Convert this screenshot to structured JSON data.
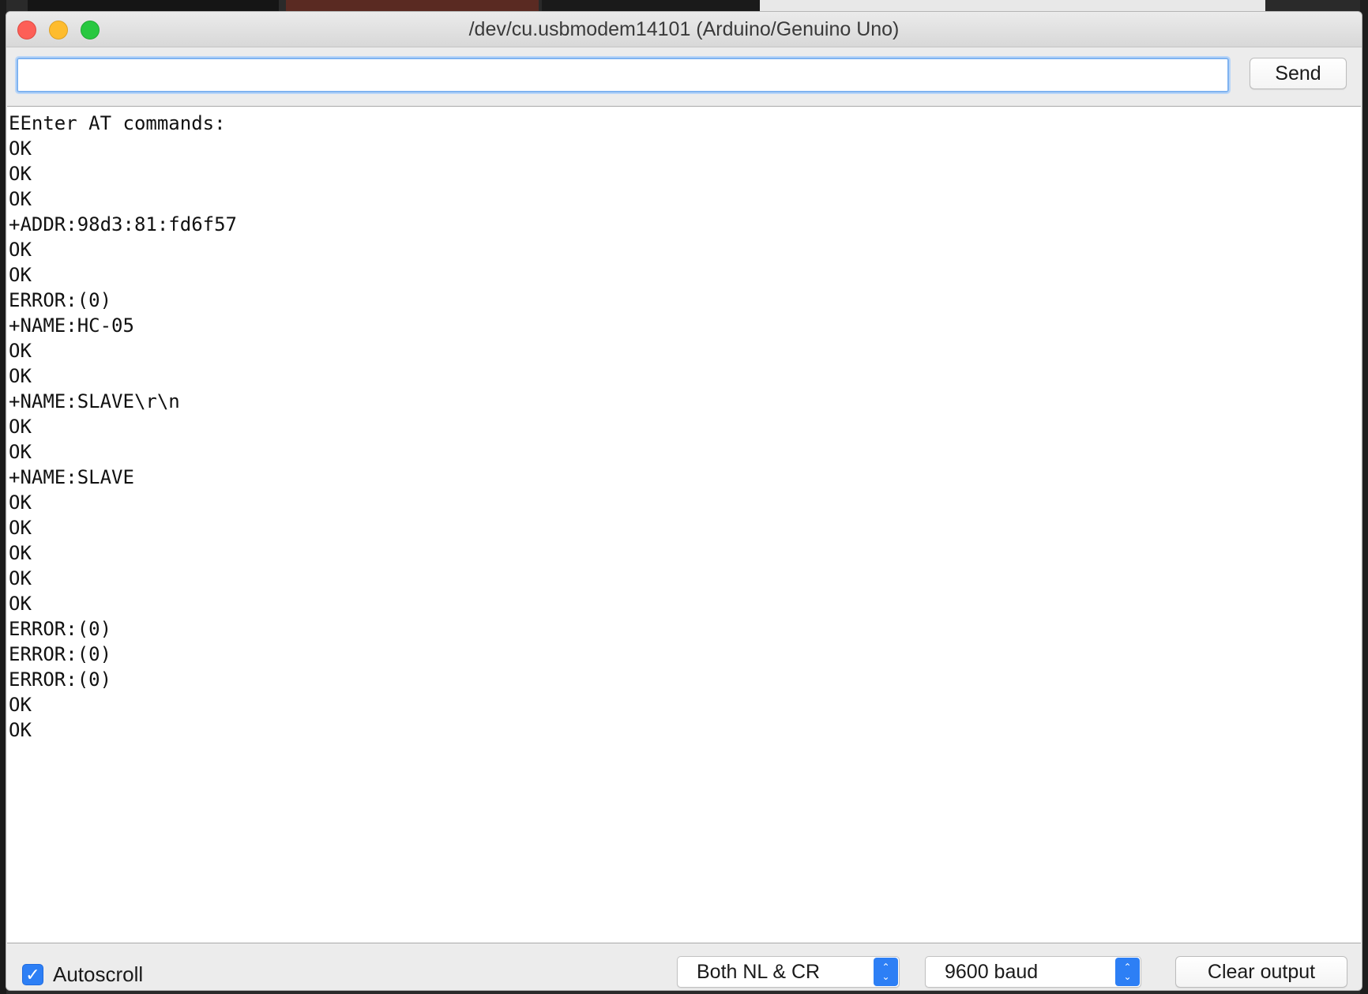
{
  "window": {
    "title": "/dev/cu.usbmodem14101 (Arduino/Genuino Uno)"
  },
  "input": {
    "value": "",
    "send_label": "Send"
  },
  "output": {
    "lines": [
      "EEnter AT commands:",
      "OK",
      "OK",
      "OK",
      "+ADDR:98d3:81:fd6f57",
      "OK",
      "OK",
      "ERROR:(0)",
      "+NAME:HC-05",
      "OK",
      "OK",
      "+NAME:SLAVE\\r\\n",
      "OK",
      "OK",
      "+NAME:SLAVE",
      "OK",
      "OK",
      "OK",
      "OK",
      "OK",
      "ERROR:(0)",
      "ERROR:(0)",
      "ERROR:(0)",
      "OK",
      "OK"
    ]
  },
  "statusbar": {
    "autoscroll_label": "Autoscroll",
    "autoscroll_checked": true,
    "line_ending": "Both NL & CR",
    "baud_rate": "9600 baud",
    "clear_label": "Clear output"
  },
  "colors": {
    "accent": "#2d7ff5",
    "close": "#fd5f57",
    "minimize": "#febc2e",
    "maximize": "#28c840"
  }
}
